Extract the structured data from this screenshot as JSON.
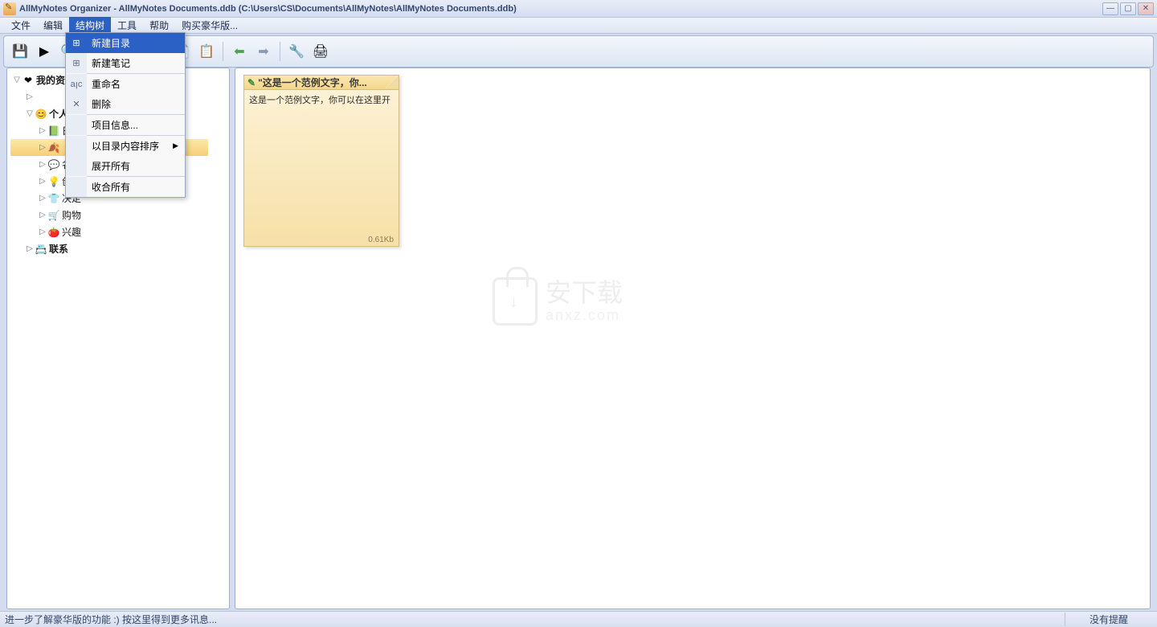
{
  "title": "AllMyNotes Organizer - AllMyNotes Documents.ddb (C:\\Users\\CS\\Documents\\AllMyNotes\\AllMyNotes Documents.ddb)",
  "menubar": [
    "文件",
    "编辑",
    "结构树",
    "工具",
    "帮助",
    "购买豪华版..."
  ],
  "menubar_active_index": 2,
  "context_menu": [
    {
      "icon": "folder-new",
      "label": "新建目录",
      "highlight": true
    },
    {
      "icon": "note-new",
      "label": "新建笔记"
    },
    {
      "sep": true
    },
    {
      "icon": "rename",
      "label": "重命名"
    },
    {
      "icon": "delete",
      "label": "删除"
    },
    {
      "sep": true
    },
    {
      "icon": "",
      "label": "项目信息..."
    },
    {
      "sep": true
    },
    {
      "icon": "",
      "label": "以目录内容排序",
      "submenu": true
    },
    {
      "icon": "",
      "label": "展开所有"
    },
    {
      "sep": true
    },
    {
      "icon": "",
      "label": "收合所有"
    }
  ],
  "toolbar_icons": [
    "save",
    "open",
    "hidden",
    "hidden",
    "hidden",
    "hidden",
    "search",
    "sep",
    "undo",
    "redo",
    "sep",
    "cut",
    "copy",
    "paste",
    "sep",
    "back",
    "forward",
    "sep",
    "settings",
    "print"
  ],
  "tree": [
    {
      "indent": 0,
      "toggle": "▽",
      "icon": "❤",
      "label": "我的资",
      "bold": true
    },
    {
      "indent": 1,
      "toggle": "▷",
      "icon": "",
      "label": ""
    },
    {
      "indent": 1,
      "toggle": "▽",
      "icon": "😊",
      "label": "个人",
      "bold": true
    },
    {
      "indent": 2,
      "toggle": "▷",
      "icon": "📗",
      "label": "日"
    },
    {
      "indent": 2,
      "toggle": "▷",
      "icon": "🍂",
      "label": "",
      "sel": true
    },
    {
      "indent": 2,
      "toggle": "▷",
      "icon": "💬",
      "label": "名"
    },
    {
      "indent": 2,
      "toggle": "▷",
      "icon": "💡",
      "label": "创"
    },
    {
      "indent": 2,
      "toggle": "▷",
      "icon": "👕",
      "label": "决定"
    },
    {
      "indent": 2,
      "toggle": "▷",
      "icon": "🛒",
      "label": "购物"
    },
    {
      "indent": 2,
      "toggle": "▷",
      "icon": "🍅",
      "label": "兴趣"
    },
    {
      "indent": 1,
      "toggle": "▷",
      "icon": "📇",
      "label": "联系",
      "bold": true
    }
  ],
  "note": {
    "title": "\"这是一个范例文字，你...",
    "body": "这是一个范例文字，你可以在这里开",
    "size": "0.61Kb"
  },
  "watermark": {
    "main": "安下载",
    "sub": "anxz.com"
  },
  "status_left": "进一步了解豪华版的功能 :) 按这里得到更多讯息...",
  "status_right": "没有提醒"
}
